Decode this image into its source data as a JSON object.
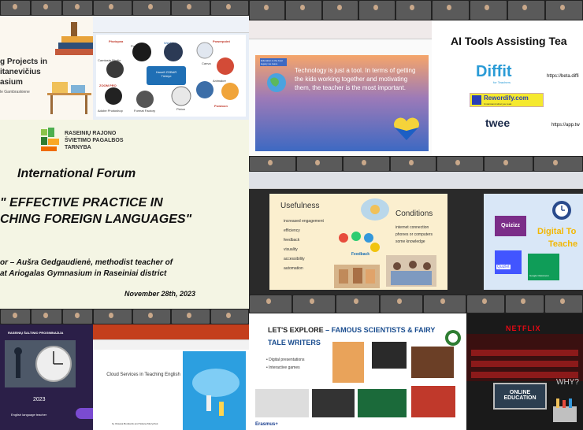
{
  "tile_tl": {
    "title_lines": [
      "g Projects in",
      "itanevičius",
      "asium"
    ],
    "small": "le Gambraskiene"
  },
  "tile_collage": {
    "items": [
      "Photopea",
      "Prezi",
      "WeVideo",
      "Powerpoint",
      "Camtasia Studio",
      "Hanefi ZOBAR",
      "Türkiye",
      "Canva",
      "Animaker",
      "ZOOM PRO",
      "Adobe Photoshop",
      "Format Factory",
      "Pixton",
      "Powtoon"
    ]
  },
  "tile_tech": {
    "note": "Education is the best legacy we leave",
    "quote": "Technology is just a tool. In terms of getting the kids working together and motivating them, the teacher is the most important."
  },
  "tile_ai": {
    "title": "AI Tools Assisting Tea",
    "diffit": "Diffit",
    "diffit_sub": "for Teachers",
    "diffit_url": "https://beta.diffi",
    "rewordify": "Rewordify.com",
    "rewordify_sub": "Understand what you read.",
    "twee": "twee",
    "twee_url": "https://app.tw"
  },
  "tile_forum": {
    "logo_line1": "RASEINIŲ RAJONO",
    "logo_line2": "ŠVIETIMO PAGALBOS",
    "logo_line3": "TARNYBA",
    "heading": "International Forum",
    "title_line1": "\" EFFECTIVE PRACTICE IN",
    "title_line2": "CHING FOREIGN LANGUAGES\"",
    "author_line1": "or – Aušra Gedgaudienė, methodist teacher of",
    "author_line2": "at Ariogalas Gymnasium in Raseiniai district",
    "date": "November 28th, 2023"
  },
  "tile_usefulness": {
    "heading_left": "Usefulness",
    "items_left": [
      "increased engagement",
      "efficiency",
      "feedback",
      "visuality",
      "accessibility",
      "automation"
    ],
    "heading_right": "Conditions",
    "items_right": [
      "internet connection",
      "phones or computers",
      "some knowledge"
    ],
    "feedback_label": "Feedback"
  },
  "tile_quizizz": {
    "quizizz": "Quizizz",
    "digital": "Digital To",
    "teacher": "Teache",
    "quizlet": "Quizlet",
    "classroom": "Google Classroom"
  },
  "tile_saltinis": {
    "school": "RASEINIŲ ŠALTINIO PROGIMNAZIJA",
    "year": "2023",
    "footer": "English language teacher"
  },
  "tile_cloud": {
    "title": "Cloud Services in Teaching English",
    "authors": "by Oksana Bondarck and Tetiana Muzychuk"
  },
  "tile_explore": {
    "title_a": "LET'S EXPLORE",
    "title_b": " – FAMOUS SCIENTISTS & FAIRY",
    "title_c": "TALE WRITERS",
    "bullets": [
      "Digital presentations",
      "Interactive games"
    ],
    "footer": "Erasmus+"
  },
  "tile_netflix": {
    "brand": "NETFLIX",
    "why": "WHY?",
    "sign_line1": "ONLINE",
    "sign_line2": "EDUCATION"
  },
  "colors": {
    "ai_diffit": "#2a9bd6",
    "forum_bg": "#f4f5e4",
    "tech_bg": "#3d69c2",
    "quizizz_bg": "#7b2d88"
  }
}
